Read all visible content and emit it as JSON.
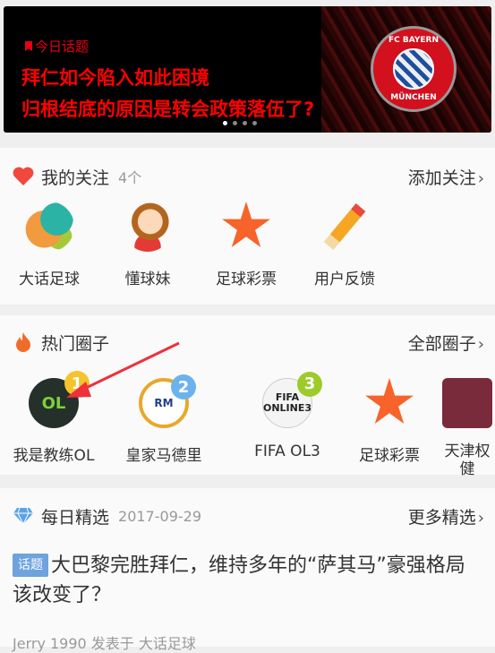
{
  "banner": {
    "tag": "今日话题",
    "line1": "拜仁如今陷入如此困境",
    "line2": "归根结底的原因是转会政策落伍了?",
    "crest_top": "FC BAYERN",
    "crest_bottom": "MÜNCHEN",
    "page_count": 4,
    "active_page": 1
  },
  "follow": {
    "title": "我的关注",
    "count": "4个",
    "more": "添加关注",
    "items": [
      {
        "label": "大话足球"
      },
      {
        "label": "懂球妹"
      },
      {
        "label": "足球彩票"
      },
      {
        "label": "用户反馈"
      }
    ]
  },
  "circles": {
    "title": "热门圈子",
    "more": "全部圈子",
    "items": [
      {
        "label": "我是教练OL",
        "rank": "1",
        "rank_color": "#f5c32c"
      },
      {
        "label": "皇家马德里",
        "rank": "2",
        "rank_color": "#6cb3ec"
      },
      {
        "label": "FIFA OL3",
        "rank": "3",
        "rank_color": "#9ccb2a"
      },
      {
        "label": "足球彩票"
      },
      {
        "label": "天津权健"
      }
    ]
  },
  "daily": {
    "title": "每日精选",
    "date": "2017-09-29",
    "more": "更多精选",
    "topic_tag": "话题",
    "topic_title": "大巴黎完胜拜仁，维持多年的“萨其马”豪强格局该改变了？",
    "footer": "Jerry 1990 发表于 大话足球"
  },
  "colors": {
    "accent_red": "#e60012",
    "heart": "#f0483e",
    "annotation_arrow": "#f0303a"
  }
}
